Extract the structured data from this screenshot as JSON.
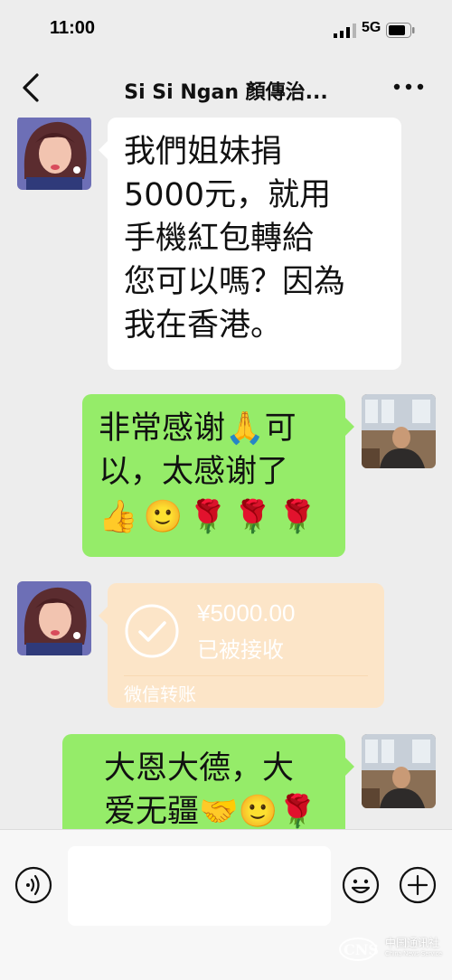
{
  "status_bar": {
    "time": "11:00",
    "network": "5G"
  },
  "nav": {
    "title": "Si Si Ngan 顏傳治..."
  },
  "messages": {
    "m1": {
      "lines": [
        "我們姐妹捐",
        "5000元，就用",
        "手機紅包轉給",
        "您可以嗎？因為",
        "我在香港。"
      ]
    },
    "m2": {
      "line1": "非常感谢",
      "line1_emoji": "🙏",
      "line1_end": "可",
      "line2": "以，太感谢了",
      "emojis": [
        "👍",
        "🙂",
        "🌹",
        "🌹",
        "🌹"
      ]
    },
    "m3": {
      "amount": "¥5000.00",
      "status": "已被接收",
      "footer": "微信转账"
    },
    "m4": {
      "line1": "大恩大德，大",
      "line2": "爱无疆",
      "emojis": [
        "🤝",
        "🙂",
        "🌹"
      ]
    }
  },
  "watermark": {
    "text": "中国通讯社",
    "sub": "China News Service"
  },
  "colors": {
    "background": "#ededed",
    "sent_bubble": "#95ec69",
    "received_bubble": "#ffffff",
    "transfer_card": "#fce5c8"
  }
}
